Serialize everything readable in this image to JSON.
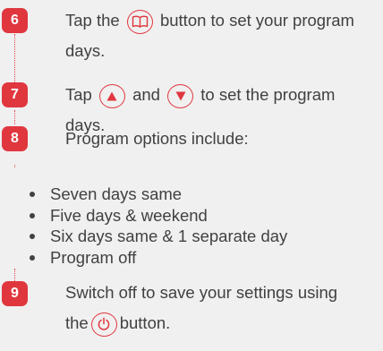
{
  "steps": [
    {
      "number": "6",
      "line1_before": "Tap the",
      "line1_after": "button to set your program",
      "line2": "days.",
      "icon": "book-icon"
    },
    {
      "number": "7",
      "line1_before": "Tap",
      "line1_mid": "and",
      "line1_after": "to set the program",
      "line2": "days.",
      "icons": [
        "up-arrow-icon",
        "down-arrow-icon"
      ]
    },
    {
      "number": "8",
      "line1": "Program options include:"
    },
    {
      "number": "9",
      "line1": "Switch off to save your settings using",
      "line2_before": "the",
      "line2_after": "button.",
      "icon": "power-icon"
    }
  ],
  "options": [
    "Seven days same",
    "Five days & weekend",
    "Six days same & 1 separate day",
    "Program off"
  ],
  "colors": {
    "accent": "#e0373f",
    "text": "#414042",
    "background": "#f0f0f0"
  }
}
